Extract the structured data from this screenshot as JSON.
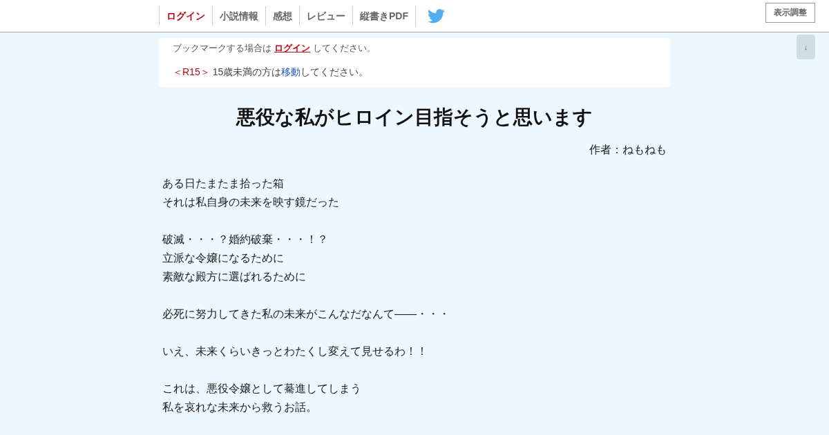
{
  "nav": {
    "items": [
      {
        "label": "ログイン",
        "color": "#c4000f"
      },
      {
        "label": "小説情報",
        "color": "#666666"
      },
      {
        "label": "感想",
        "color": "#666666"
      },
      {
        "label": "レビュー",
        "color": "#666666"
      },
      {
        "label": "縦書きPDF",
        "color": "#666666"
      }
    ],
    "display_button": "表示調整"
  },
  "scroll_button": "↓",
  "notice": {
    "bookmark": {
      "before": "ブックマークする場合は",
      "link": "ログイン",
      "after": "してください。"
    },
    "rating": {
      "tag": "＜R15＞",
      "before": "15歳未満の方は",
      "link": "移動",
      "after": "してください。"
    }
  },
  "title": "悪役な私がヒロイン目指そうと思います",
  "author": "作者：ねもねも",
  "synopsis": [
    [
      "ある日たまたま拾った箱",
      "それは私自身の未来を映す鏡だった"
    ],
    [
      "破滅・・・？婚約破棄・・・！？",
      "立派な令嬢になるために",
      "素敵な殿方に選ばれるために"
    ],
    [
      "必死に努力してきた私の未来がこんなだなんて――・・・"
    ],
    [
      "いえ、未来くらいきっとわたくし変えて見せるわ！！"
    ],
    [
      "これは、悪役令嬢として驀進してしまう",
      "私を哀れな未来から救うお話。"
    ]
  ]
}
